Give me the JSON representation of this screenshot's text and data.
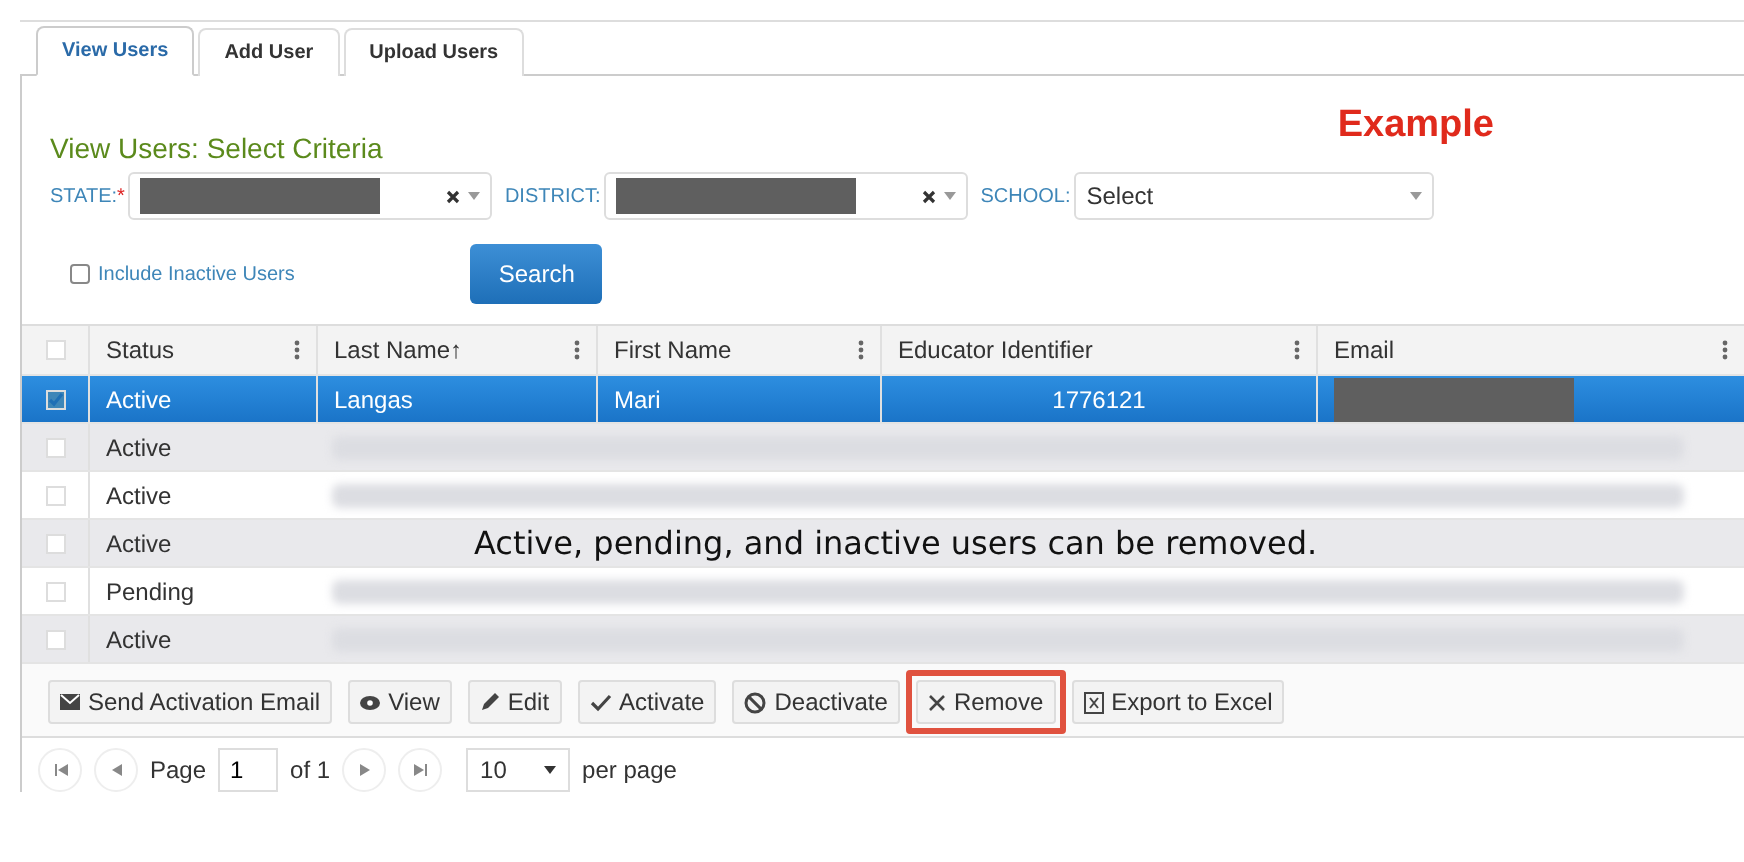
{
  "tabs": [
    {
      "label": "View Users",
      "selected": true
    },
    {
      "label": "Add User",
      "selected": false
    },
    {
      "label": "Upload Users",
      "selected": false
    }
  ],
  "example_label": "Example",
  "criteria": {
    "title": "View Users: Select Criteria",
    "filters": [
      {
        "label": "STATE:",
        "required_mark": "*",
        "redacted": true,
        "clearable": true
      },
      {
        "label": "DISTRICT:",
        "redacted": true,
        "clearable": true
      },
      {
        "label": "SCHOOL:",
        "value": "Select"
      }
    ],
    "include_inactive": {
      "label": "Include Inactive Users",
      "checked": false
    },
    "search_button": "Search"
  },
  "table": {
    "select_all_checked": false,
    "columns": [
      {
        "label": "Status"
      },
      {
        "label": "Last Name",
        "sort_indicator": "↑"
      },
      {
        "label": "First Name"
      },
      {
        "label": "Educator Identifier"
      },
      {
        "label": "Email"
      }
    ],
    "rows": [
      {
        "selected": true,
        "status": "Active",
        "last_name": "Langas",
        "first_name": "Mari",
        "educator_identifier": "1776121",
        "email_redacted": true
      },
      {
        "selected": false,
        "status": "Active",
        "blurred": true
      },
      {
        "selected": false,
        "status": "Active",
        "blurred": true
      },
      {
        "selected": false,
        "status": "Active",
        "blurred": false
      },
      {
        "selected": false,
        "status": "Pending",
        "blurred": true
      },
      {
        "selected": false,
        "status": "Active",
        "blurred": true
      }
    ]
  },
  "caption": "Active, pending, and inactive users can be removed.",
  "actions": [
    {
      "kind": "email",
      "label": "Send Activation Email",
      "highlighted": false
    },
    {
      "kind": "view",
      "label": "View",
      "highlighted": false
    },
    {
      "kind": "edit",
      "label": "Edit",
      "highlighted": false
    },
    {
      "kind": "activate",
      "label": "Activate",
      "highlighted": false
    },
    {
      "kind": "deactivate",
      "label": "Deactivate",
      "highlighted": false
    },
    {
      "kind": "remove",
      "label": "Remove",
      "highlighted": true
    },
    {
      "kind": "export",
      "label": "Export to Excel",
      "highlighted": false
    }
  ],
  "pager": {
    "page_label": "Page",
    "page": "1",
    "of": "of 1",
    "per_page": "10",
    "per_page_label": "per page"
  }
}
